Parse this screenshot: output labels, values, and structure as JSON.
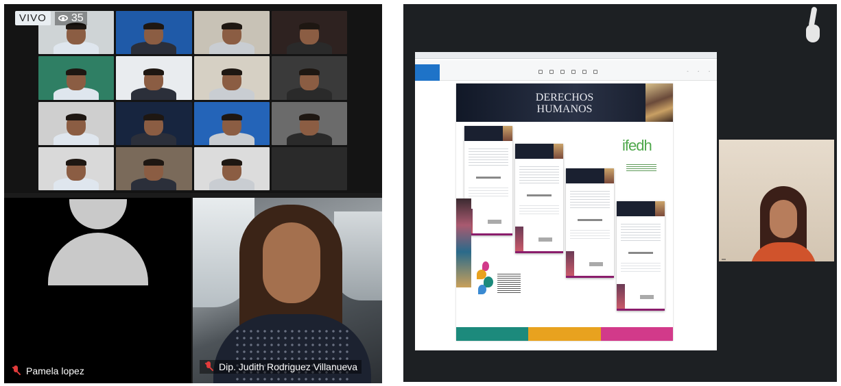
{
  "live": {
    "badge": "VIVO",
    "viewers": "35"
  },
  "gallery": {
    "tiles": [
      {
        "bg": "#cfd4d6"
      },
      {
        "bg": "#1f5aa8"
      },
      {
        "bg": "#c8c2b6"
      },
      {
        "bg": "#2e2220"
      },
      {
        "bg": "#2f7f64"
      },
      {
        "bg": "#e9ecef"
      },
      {
        "bg": "#d6d0c4"
      },
      {
        "bg": "#3a3a3a"
      },
      {
        "bg": "#cfcfcf"
      },
      {
        "bg": "#17253f"
      },
      {
        "bg": "#2464b8"
      },
      {
        "bg": "#6b6b6b"
      },
      {
        "bg": "#d9d9d9"
      },
      {
        "bg": "#7a6a5a"
      },
      {
        "bg": "#dcdcdc"
      },
      {
        "bg": "#2a2a2a"
      }
    ]
  },
  "participants": {
    "pamela": {
      "name": "Pamela lopez"
    },
    "judith": {
      "name": "Dip. Judith Rodriguez Villanueva"
    }
  },
  "presentation": {
    "banner_title": "DERECHOS HUMANOS",
    "logo_text": "ifedh",
    "stripe_colors": [
      "#1c8a7c",
      "#e8a21f",
      "#d23a8a"
    ]
  }
}
